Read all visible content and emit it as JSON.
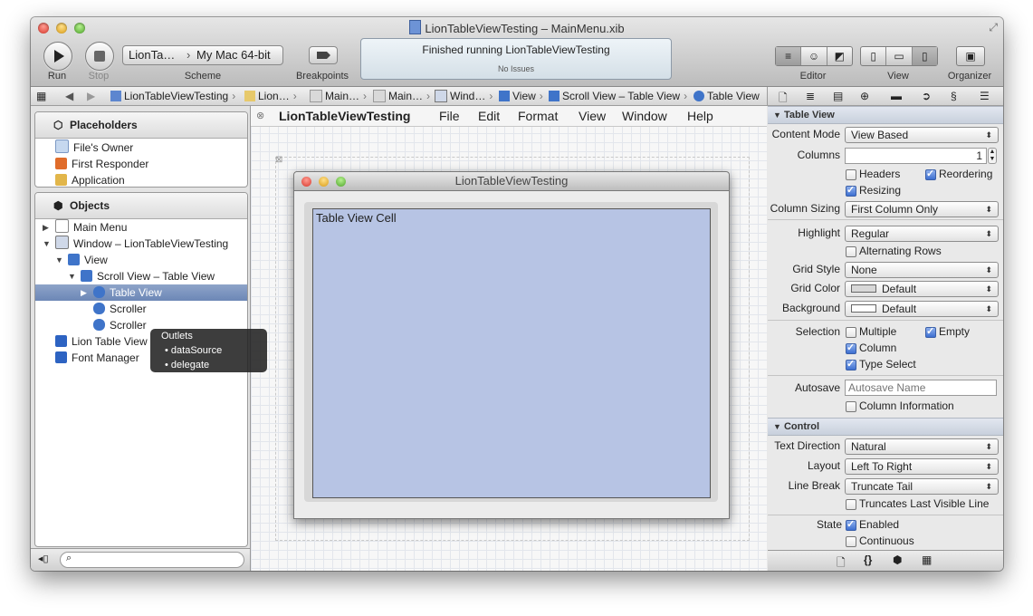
{
  "window": {
    "title": "LionTableViewTesting – MainMenu.xib"
  },
  "toolbar": {
    "run_label": "Run",
    "stop_label": "Stop",
    "scheme_target": "LionTa…",
    "scheme_destination": "My Mac 64-bit",
    "scheme_label": "Scheme",
    "breakpoints_label": "Breakpoints",
    "activity_status": "Finished running LionTableViewTesting",
    "activity_issues": "No Issues",
    "editor_label": "Editor",
    "view_label": "View",
    "organizer_label": "Organizer"
  },
  "jumpbar": {
    "items": [
      "LionTableViewTesting",
      "Lion…",
      "Main…",
      "Main…",
      "Wind…",
      "View",
      "Scroll View – Table View",
      "Table View"
    ]
  },
  "placeholders": {
    "header": "Placeholders",
    "items": [
      "File's Owner",
      "First Responder",
      "Application"
    ]
  },
  "objects": {
    "header": "Objects",
    "items": [
      "Main Menu",
      "Window – LionTableViewTesting",
      "View",
      "Scroll View – Table View",
      "Table View",
      "Scroller",
      "Scroller",
      "Lion Table View",
      "Font Manager"
    ]
  },
  "outlets_popup": {
    "title": "Outlets",
    "items": [
      "dataSource",
      "delegate"
    ]
  },
  "canvas": {
    "menu": [
      "LionTableViewTesting",
      "File",
      "Edit",
      "Format",
      "View",
      "Window",
      "Help"
    ],
    "window_title": "LionTableViewTesting",
    "cell_text": "Table View Cell"
  },
  "inspector": {
    "table_view": {
      "header": "Table View",
      "content_mode_label": "Content Mode",
      "content_mode": "View Based",
      "columns_label": "Columns",
      "columns": "1",
      "headers": "Headers",
      "reordering": "Reordering",
      "resizing": "Resizing",
      "column_sizing_label": "Column Sizing",
      "column_sizing": "First Column Only",
      "highlight_label": "Highlight",
      "highlight": "Regular",
      "alternating_rows": "Alternating Rows",
      "grid_style_label": "Grid Style",
      "grid_style": "None",
      "grid_color_label": "Grid Color",
      "grid_color": "Default",
      "background_label": "Background",
      "background": "Default",
      "selection_label": "Selection",
      "multiple": "Multiple",
      "empty": "Empty",
      "column": "Column",
      "type_select": "Type Select",
      "autosave_label": "Autosave",
      "autosave_placeholder": "Autosave Name",
      "column_information": "Column Information"
    },
    "control": {
      "header": "Control",
      "text_direction_label": "Text Direction",
      "text_direction": "Natural",
      "layout_label": "Layout",
      "layout": "Left To Right",
      "line_break_label": "Line Break",
      "line_break": "Truncate Tail",
      "truncates_last_visible_line": "Truncates Last Visible Line",
      "state_label": "State",
      "enabled": "Enabled",
      "continuous": "Continuous"
    }
  },
  "colors": {
    "selection": "#6c87b6",
    "table_fill": "#b7c4e4",
    "section_header": "#c8d0dc"
  }
}
